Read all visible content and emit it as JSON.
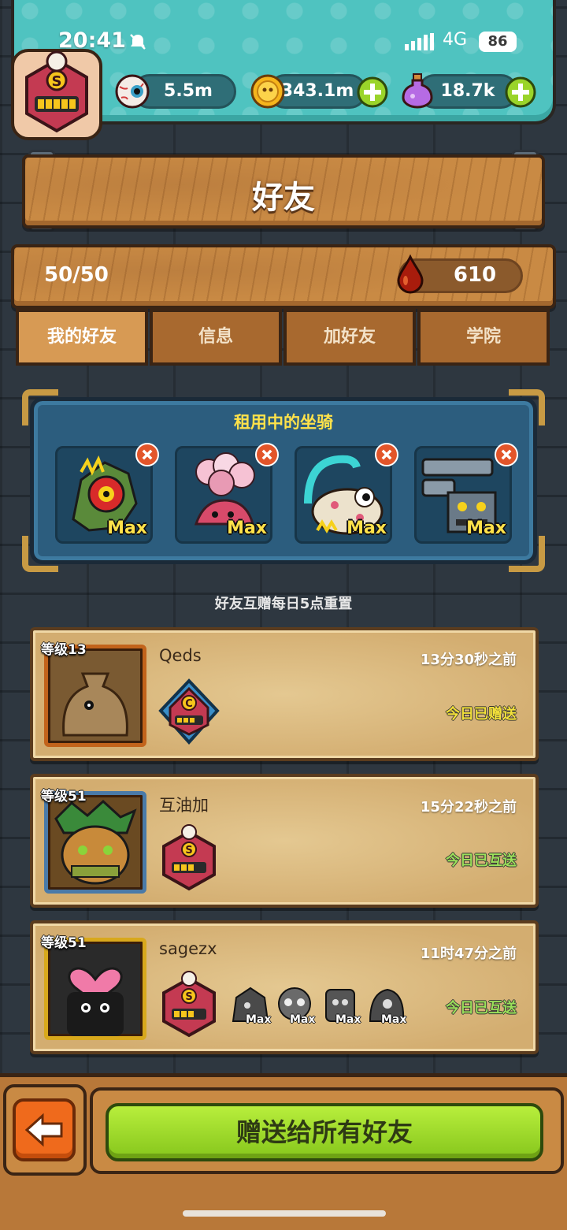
{
  "status_bar": {
    "time": "20:41",
    "network": "4G",
    "battery": "86"
  },
  "resources": {
    "eyes": {
      "value": "5.5m",
      "icon": "eyeball-icon"
    },
    "coins": {
      "value": "343.1m",
      "icon": "coin-icon"
    },
    "potion": {
      "value": "18.7k",
      "icon": "potion-icon"
    }
  },
  "page_title": "好友",
  "friend_count": "50/50",
  "blood_currency": "610",
  "tabs": [
    {
      "label": "我的好友",
      "active": true
    },
    {
      "label": "信息",
      "active": false
    },
    {
      "label": "加好友",
      "active": false
    },
    {
      "label": "学院",
      "active": false
    }
  ],
  "rental": {
    "title": "租用中的坐骑",
    "mounts": [
      {
        "name": "dragon-mount",
        "badge": "Max"
      },
      {
        "name": "balloon-mount",
        "badge": "Max"
      },
      {
        "name": "slug-mount",
        "badge": "Max"
      },
      {
        "name": "machine-mount",
        "badge": "Max"
      }
    ]
  },
  "reset_note": "好友互赠每日5点重置",
  "friends": [
    {
      "level": "等级13",
      "name": "Qeds",
      "time": "13分30秒之前",
      "status": "今日已赠送",
      "status_color": "#f4e23a",
      "badge": "C"
    },
    {
      "level": "等级51",
      "name": "互油加",
      "time": "15分22秒之前",
      "status": "今日已互送",
      "status_color": "#9be05a",
      "badge": "S"
    },
    {
      "level": "等级51",
      "name": "sagezx",
      "time": "11时47分之前",
      "status": "今日已互送",
      "status_color": "#9be05a",
      "badge": "S",
      "mini_mounts": [
        "Max",
        "Max",
        "Max",
        "Max"
      ]
    }
  ],
  "gift_all_label": "赠送给所有好友"
}
